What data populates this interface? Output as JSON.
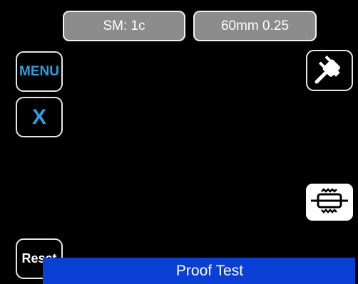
{
  "header": {
    "mode_label": "SM: 1c",
    "setting_label": "60mm 0.25"
  },
  "left_panel": {
    "menu_label": "MENU",
    "close_label": "X",
    "reset_label": "Reset"
  },
  "right_panel": {
    "power_icon": "plug-icon",
    "splice_icon": "splice-sleeve-icon"
  },
  "status": {
    "text": "Proof Test"
  },
  "colors": {
    "background": "#000000",
    "pill_fill": "#8c8c8c",
    "accent_blue_text": "#2b9fe3",
    "status_bar": "#0a3fd6"
  }
}
